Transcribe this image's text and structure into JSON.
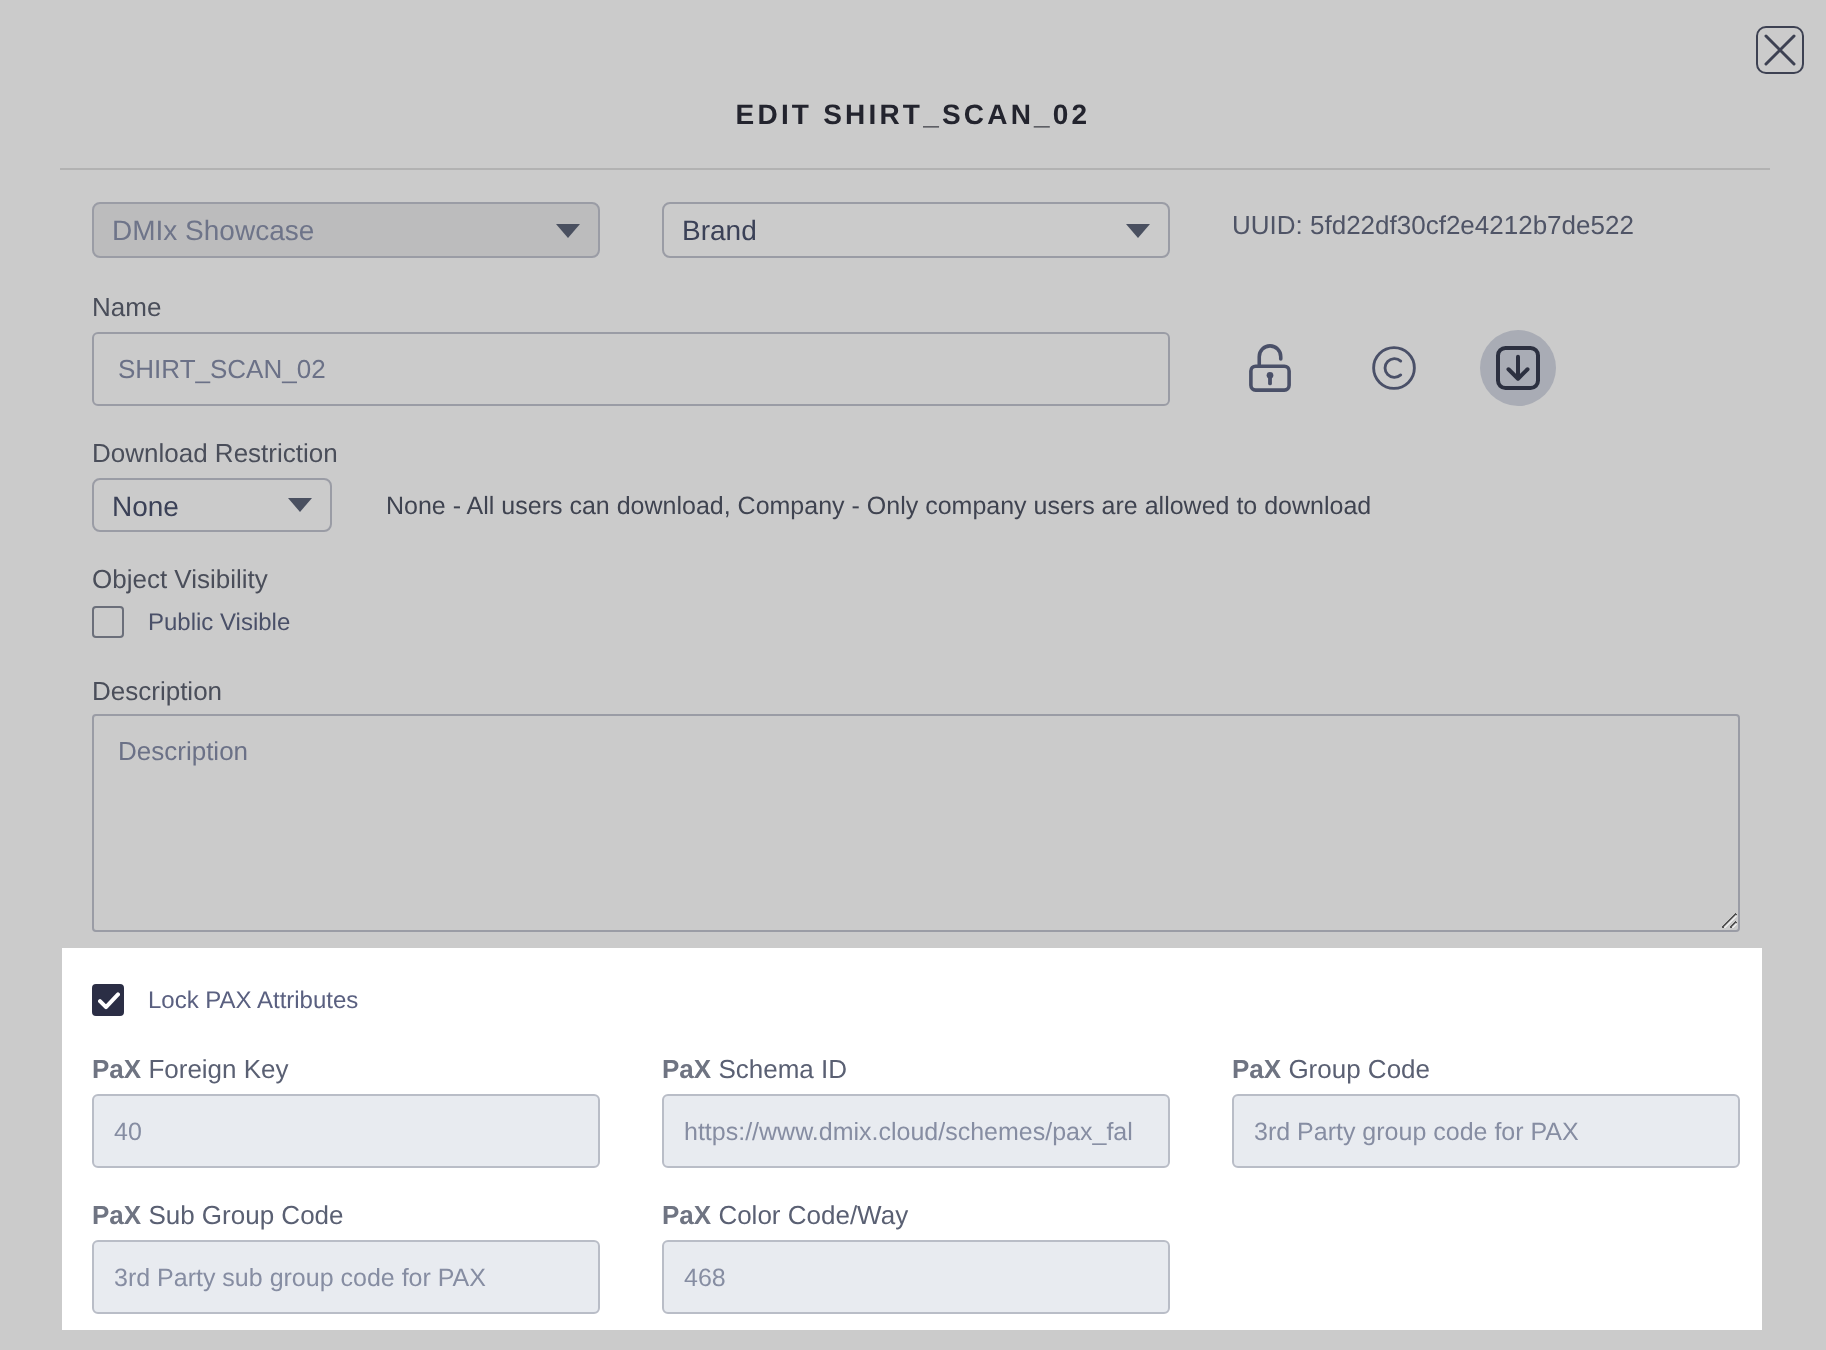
{
  "dialog": {
    "title": "EDIT SHIRT_SCAN_02"
  },
  "selectors": [
    {
      "value": "DMIx Showcase",
      "disabled": true
    },
    {
      "value": "Brand",
      "disabled": false
    }
  ],
  "uuid": "UUID: 5fd22df30cf2e4212b7de522",
  "name_field": {
    "label": "Name",
    "value": "SHIRT_SCAN_02"
  },
  "icon_buttons": [
    {
      "kind": "lock",
      "active": false
    },
    {
      "kind": "copyright",
      "active": false
    },
    {
      "kind": "download",
      "active": true
    }
  ],
  "download_restriction": {
    "label": "Download Restriction",
    "value": "None",
    "help": "None - All users can download, Company - Only company users are allowed to download"
  },
  "object_visibility": {
    "label": "Object Visibility",
    "checkbox": {
      "label": "Public Visible",
      "checked": false
    }
  },
  "description": {
    "label": "Description",
    "placeholder": "Description"
  },
  "pax_section": {
    "highlighted": true,
    "lock": {
      "label": "Lock PAX Attributes",
      "checked": true
    },
    "fields": [
      {
        "label": "**PaX** Foreign Key",
        "value": "40",
        "disabled": true
      },
      {
        "label": "**PaX** Schema ID",
        "value": "https://www.dmix.cloud/schemes/pax_fal",
        "disabled": true
      },
      {
        "label": "**PaX** Group Code",
        "placeholder": "3rd Party group code for PAX",
        "disabled": true
      },
      {
        "label": "**PaX** Sub Group Code",
        "placeholder": "3rd Party sub group code for PAX",
        "disabled": true
      },
      {
        "label": "**PaX** Color Code/Way",
        "value": "468",
        "disabled": true
      }
    ]
  }
}
